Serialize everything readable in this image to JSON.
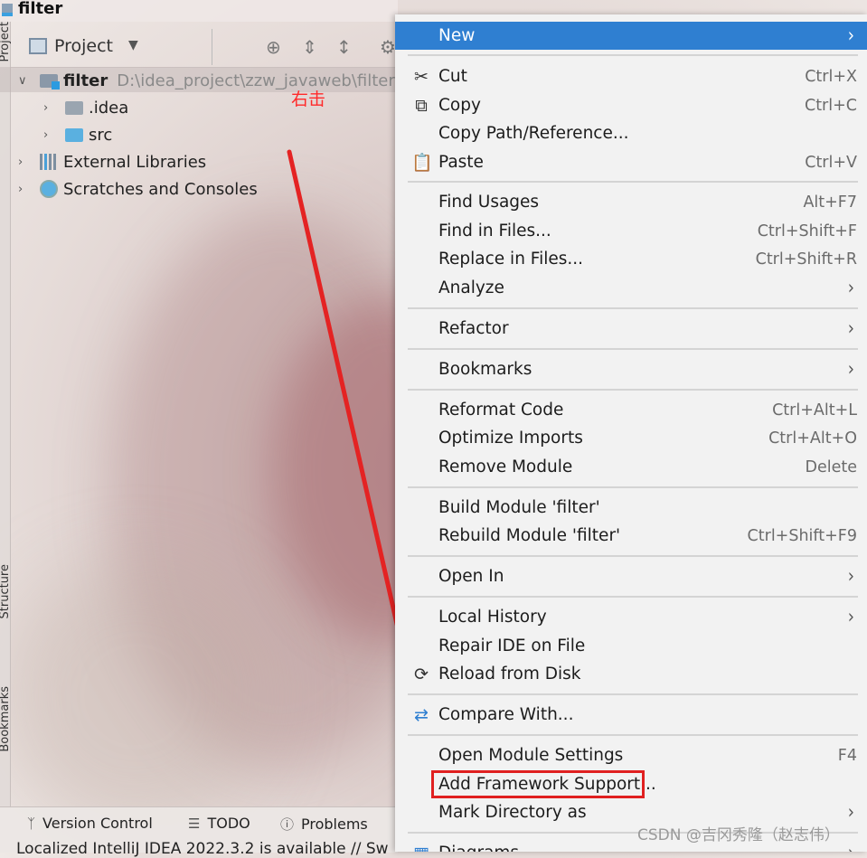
{
  "window": {
    "title": "filter"
  },
  "sidebar_tabs": {
    "project": "Project",
    "structure": "Structure",
    "bookmarks": "Bookmarks"
  },
  "toolbar": {
    "view_label": "Project"
  },
  "tree": [
    {
      "name": "filter",
      "path": "D:\\idea_project\\zzw_javaweb\\filter",
      "icon": "module-folder-icon",
      "expanded": true
    },
    {
      "name": ".idea",
      "icon": "folder-icon"
    },
    {
      "name": "src",
      "icon": "source-folder-icon"
    },
    {
      "name": "External Libraries",
      "icon": "libraries-icon"
    },
    {
      "name": "Scratches and Consoles",
      "icon": "scratches-icon"
    }
  ],
  "annotation": {
    "text": "右击",
    "color": "#ff2a2a"
  },
  "bottom_tabs": [
    {
      "label": "Version Control",
      "icon": "version-control-icon"
    },
    {
      "label": "TODO",
      "icon": "list-icon"
    },
    {
      "label": "Problems",
      "icon": "problems-icon"
    }
  ],
  "notification": "Localized IntelliJ IDEA 2022.3.2 is available // Sw",
  "context_menu": {
    "highlight_color": "#2f7fd1",
    "items": [
      {
        "label": "New",
        "submenu": true,
        "highlighted": true
      },
      {
        "label": "Cut",
        "shortcut": "Ctrl+X",
        "icon": "scissors-icon"
      },
      {
        "label": "Copy",
        "shortcut": "Ctrl+C",
        "icon": "copy-icon"
      },
      {
        "label": "Copy Path/Reference..."
      },
      {
        "label": "Paste",
        "shortcut": "Ctrl+V",
        "icon": "clipboard-icon"
      },
      {
        "label": "Find Usages",
        "shortcut": "Alt+F7"
      },
      {
        "label": "Find in Files...",
        "shortcut": "Ctrl+Shift+F"
      },
      {
        "label": "Replace in Files...",
        "shortcut": "Ctrl+Shift+R"
      },
      {
        "label": "Analyze",
        "submenu": true
      },
      {
        "label": "Refactor",
        "submenu": true
      },
      {
        "label": "Bookmarks",
        "submenu": true
      },
      {
        "label": "Reformat Code",
        "shortcut": "Ctrl+Alt+L"
      },
      {
        "label": "Optimize Imports",
        "shortcut": "Ctrl+Alt+O"
      },
      {
        "label": "Remove Module",
        "shortcut": "Delete"
      },
      {
        "label": "Build Module 'filter'"
      },
      {
        "label": "Rebuild Module 'filter'",
        "shortcut": "Ctrl+Shift+F9"
      },
      {
        "label": "Open In",
        "submenu": true
      },
      {
        "label": "Local History",
        "submenu": true
      },
      {
        "label": "Repair IDE on File"
      },
      {
        "label": "Reload from Disk",
        "icon": "reload-icon"
      },
      {
        "label": "Compare With...",
        "icon": "compare-icon"
      },
      {
        "label": "Open Module Settings",
        "shortcut": "F4"
      },
      {
        "label": "Add Framework Support...",
        "boxed": true
      },
      {
        "label": "Mark Directory as",
        "submenu": true
      },
      {
        "label": "Diagrams",
        "submenu": true,
        "icon": "diagram-icon"
      }
    ]
  },
  "watermark": "CSDN @吉冈秀隆（赵志伟）"
}
